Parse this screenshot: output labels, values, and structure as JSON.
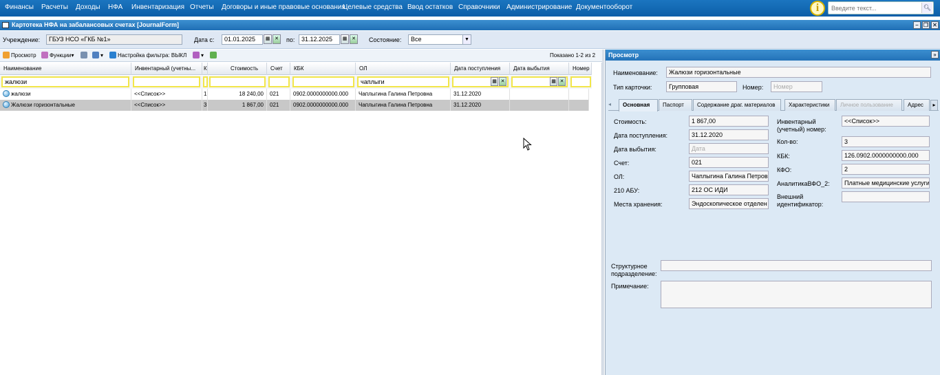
{
  "menu": [
    "Финансы",
    "Расчеты",
    "Доходы",
    "НФА",
    "Инвентаризация",
    "Отчеты",
    "Договоры и иные правовые основания",
    "Целевые средства",
    "Ввод остатков",
    "Справочники",
    "Администрирование",
    "Документооборот"
  ],
  "search": {
    "placeholder": "Введите текст..."
  },
  "window": {
    "title": "Картотека НФА на забалансовых счетах [JournalForm]"
  },
  "filter": {
    "institution_label": "Учреждение:",
    "institution_value": "ГБУЗ НСО «ГКБ №1»",
    "date_from_label": "Дата с:",
    "date_from": "01.01.2025",
    "date_to_label": "по:",
    "date_to": "31.12.2025",
    "state_label": "Состояние:",
    "state_value": "Все"
  },
  "toolbar": {
    "view": "Просмотр",
    "functions": "Функции",
    "filter_setting": "Настройка фильтра: ВЫКЛ",
    "shown": "Показано 1-2 из 2"
  },
  "grid": {
    "columns": [
      "Наименование",
      "Инвентарный (учетны...",
      "Кол",
      "Стоимость",
      "Счет",
      "КБК",
      "ОЛ",
      "Дата поступления",
      "Дата выбытия",
      "Номер"
    ],
    "filters": {
      "name": "жалюзи",
      "ol": "чаплыги"
    },
    "rows": [
      {
        "name": "жалюзи",
        "inv": "<<Список>>",
        "qty": "1",
        "cost": "18 240,00",
        "account": "021",
        "kbk": "0902.0000000000.000",
        "ol": "Чаплыгина Галина Петровна",
        "date_in": "31.12.2020",
        "date_out": "",
        "num": ""
      },
      {
        "name": "Жалюзи горизонтальные",
        "inv": "<<Список>>",
        "qty": "3",
        "cost": "1 867,00",
        "account": "021",
        "kbk": "0902.0000000000.000",
        "ol": "Чаплыгина Галина Петровна",
        "date_in": "31.12.2020",
        "date_out": "",
        "num": ""
      }
    ]
  },
  "view_panel": {
    "title": "Просмотр",
    "name_label": "Наименование:",
    "name_value": "Жалюзи горизонтальные",
    "card_type_label": "Тип карточки:",
    "card_type_value": "Групповая",
    "number_label": "Номер:",
    "number_placeholder": "Номер",
    "tabs": [
      "Основная",
      "Паспорт",
      "Содержание драг. материалов",
      "Характеристики",
      "Личное пользование",
      "Адрес"
    ],
    "fields_left": [
      {
        "label": "Стоимость:",
        "value": "1 867,00"
      },
      {
        "label": "Дата поступления:",
        "value": "31.12.2020"
      },
      {
        "label": "Дата выбытия:",
        "value": "Дата"
      },
      {
        "label": "Счет:",
        "value": "021"
      },
      {
        "label": "ОЛ:",
        "value": "Чаплыгина Галина Петров"
      },
      {
        "label": "210 АБУ:",
        "value": "212 ОС ИДИ"
      },
      {
        "label": "Места хранения:",
        "value": "Эндоскопическое отделен"
      }
    ],
    "fields_right": [
      {
        "label": "Инвентарный (учетный) номер:",
        "value": "<<Список>>"
      },
      {
        "label": "Кол-во:",
        "value": "3"
      },
      {
        "label": "КБК:",
        "value": "126.0902.0000000000.000"
      },
      {
        "label": "КФО:",
        "value": "2"
      },
      {
        "label": "АналитикаВФО_2:",
        "value": "Платные медицинские услуги"
      },
      {
        "label": "Внешний идентификатор:",
        "value": ""
      }
    ],
    "struct_label": "Структурное подразделение:",
    "struct_value": "",
    "note_label": "Примечание:",
    "note_value": ""
  }
}
